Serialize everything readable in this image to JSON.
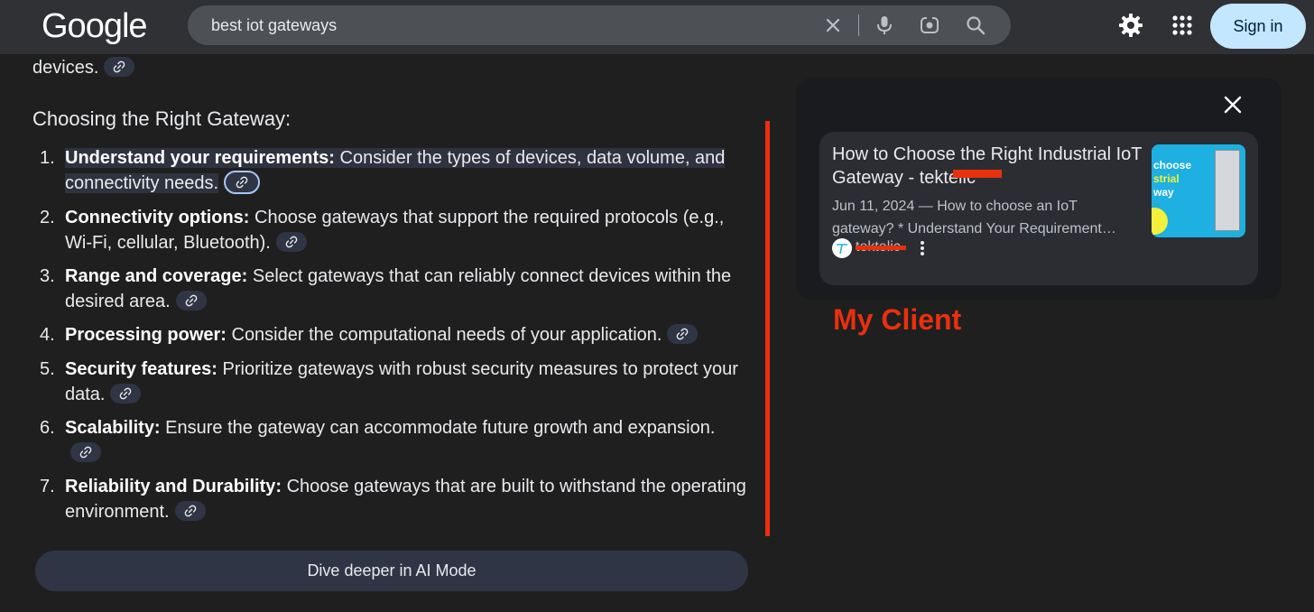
{
  "header": {
    "logo": "Google",
    "search": {
      "value": "best iot gateways"
    },
    "icons": [
      "clear-icon",
      "mic-icon",
      "lens-icon",
      "search-icon",
      "gear-icon",
      "apps-icon"
    ],
    "sign_in_label": "Sign in"
  },
  "content": {
    "partial_text": "devices.",
    "section_title": "Choosing the Right Gateway:",
    "items": [
      {
        "number": "1.",
        "bold": "Understand your requirements:",
        "text": " Consider the types of devices, data volume, and connectivity needs."
      },
      {
        "number": "2.",
        "bold": "Connectivity options:",
        "text": " Choose gateways that support the required protocols (e.g., Wi-Fi, cellular, Bluetooth)."
      },
      {
        "number": "3.",
        "bold": "Range and coverage:",
        "text": " Select gateways that can reliably connect devices within the desired area."
      },
      {
        "number": "4.",
        "bold": "Processing power:",
        "text": " Consider the computational needs of your application."
      },
      {
        "number": "5.",
        "bold": "Security features:",
        "text": " Prioritize gateways with robust security measures to protect your data."
      },
      {
        "number": "6.",
        "bold": "Scalability:",
        "text": " Ensure the gateway can accommodate future growth and expansion."
      },
      {
        "number": "7.",
        "bold": "Reliability and Durability:",
        "text": " Choose gateways that are built to withstand the operating environment."
      }
    ],
    "dive_deeper_label": "Dive deeper in AI Mode"
  },
  "side_panel": {
    "card": {
      "title": "How to Choose the Right Industrial IoT Gateway - tektelic",
      "snippet_line1": "Jun 11, 2024 — How to choose an IoT",
      "snippet_line2": "gateway? * Understand Your Requirement…",
      "thumbnail_text_line1": "choose",
      "thumbnail_text_line2": "strial",
      "thumbnail_text_line3": "way",
      "source": "tektelic"
    }
  },
  "annotation": "My Client",
  "colors": {
    "background": "#1f1f1f",
    "header": "#303134",
    "accent_red": "#e8300f",
    "sign_in_bg": "#c2e7ff",
    "chip_bg": "#303545"
  }
}
